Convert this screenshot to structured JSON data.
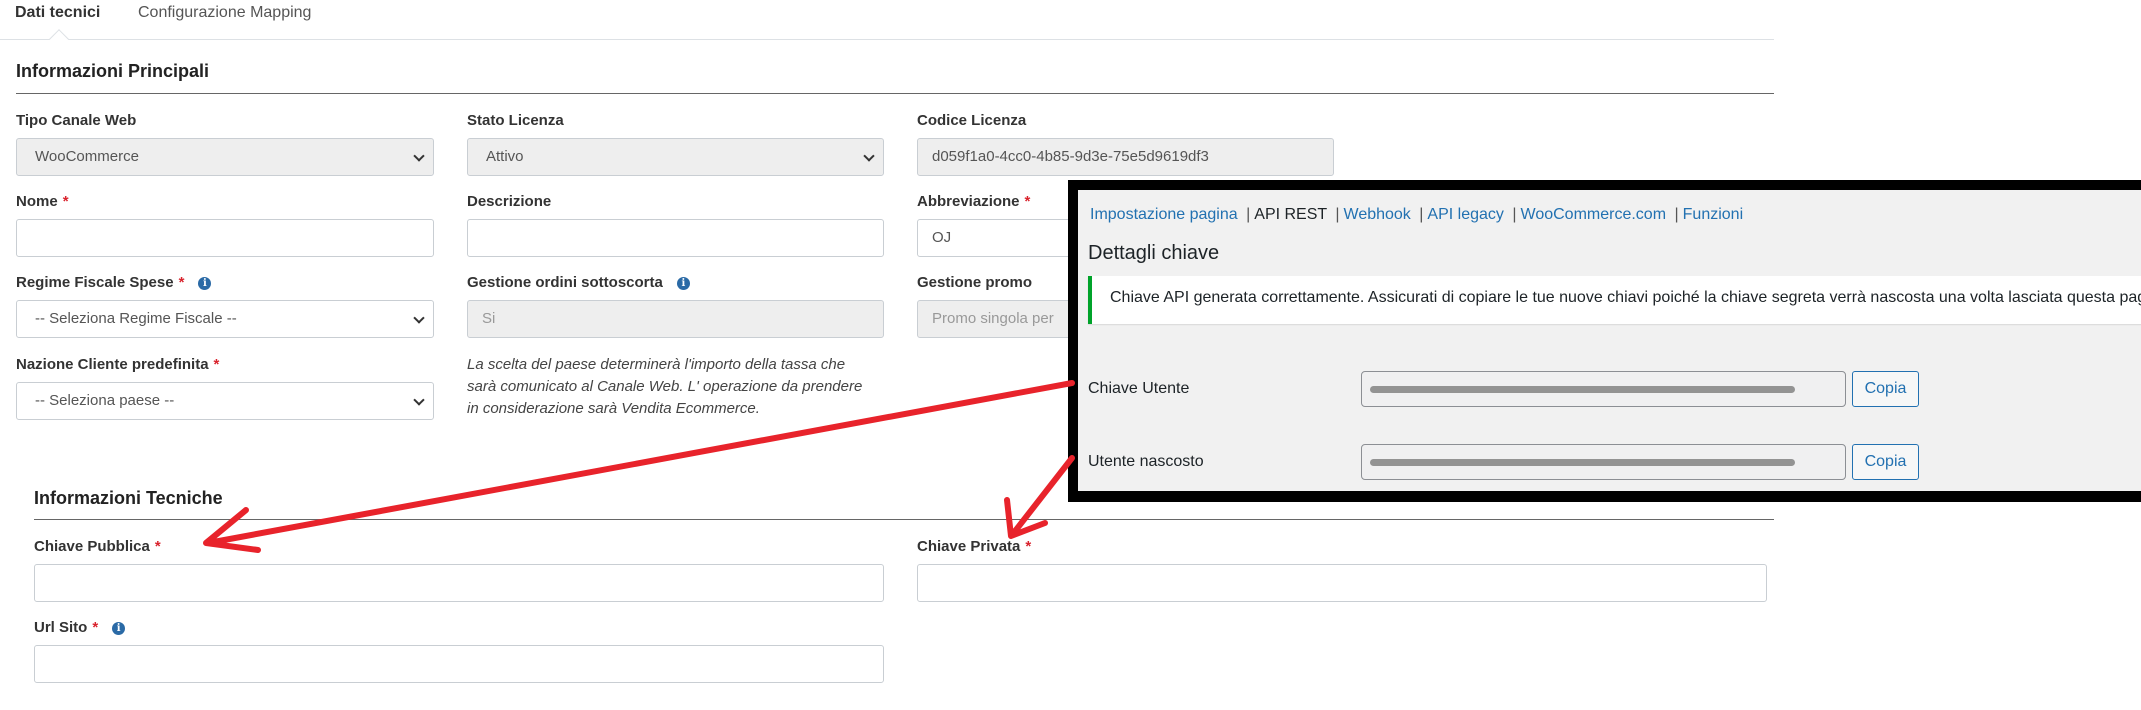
{
  "tabs": [
    {
      "label": "Dati tecnici"
    },
    {
      "label": "Configurazione Mapping"
    }
  ],
  "main_section": {
    "title": "Informazioni Principali",
    "fields": {
      "tipo_canale": {
        "label": "Tipo Canale Web",
        "value": "WooCommerce"
      },
      "stato_licenza": {
        "label": "Stato Licenza",
        "value": "Attivo"
      },
      "codice_licenza": {
        "label": "Codice Licenza",
        "value": "d059f1a0-4cc0-4b85-9d3e-75e5d9619df3"
      },
      "nome": {
        "label": "Nome",
        "required": "*",
        "value": ""
      },
      "descrizione": {
        "label": "Descrizione",
        "value": ""
      },
      "abbreviazione": {
        "label": "Abbreviazione",
        "required": "*",
        "value": "OJ"
      },
      "regime_fiscale": {
        "label": "Regime Fiscale Spese",
        "required": "*",
        "value": "-- Seleziona Regime Fiscale --"
      },
      "gestione_ordini": {
        "label": "Gestione ordini sottoscorta",
        "value": "Si"
      },
      "gestione_promo": {
        "label": "Gestione promo",
        "value": "Promo singola per"
      },
      "nazione_cliente": {
        "label": "Nazione Cliente predefinita",
        "required": "*",
        "value": "-- Seleziona paese --"
      }
    },
    "note_lines": [
      "La scelta del paese determinerà l'importo della tassa che",
      "sarà comunicato al Canale Web. L' operazione da prendere",
      "in considerazione sarà Vendita Ecommerce."
    ]
  },
  "tech_section": {
    "title": "Informazioni Tecniche",
    "fields": {
      "chiave_pubblica": {
        "label": "Chiave Pubblica",
        "required": "*",
        "value": ""
      },
      "chiave_privata": {
        "label": "Chiave Privata",
        "required": "*",
        "value": ""
      },
      "url_sito": {
        "label": "Url Sito",
        "required": "*",
        "value": ""
      }
    }
  },
  "overlay": {
    "subnav": {
      "items": [
        "Impostazione pagina",
        "API REST",
        "Webhook",
        "API legacy",
        "WooCommerce.com",
        "Funzioni"
      ],
      "separator": "|",
      "current": "API REST"
    },
    "title": "Dettagli chiave",
    "notice": "Chiave API generata correttamente. Assicurati di copiare le tue nuove chiavi poiché la chiave segreta verrà nascosta una volta lasciata questa pag",
    "rows": [
      {
        "label": "Chiave Utente",
        "button": "Copia"
      },
      {
        "label": "Utente nascosto",
        "button": "Copia"
      }
    ]
  },
  "colors": {
    "required": "#d9232d",
    "info_icon": "#2a6aa6",
    "arrow": "#e8232b",
    "notice_border": "#00a32a",
    "wp_link": "#2271b1"
  },
  "icons": {
    "info": "info-icon",
    "select": "chevron-down-icon"
  }
}
